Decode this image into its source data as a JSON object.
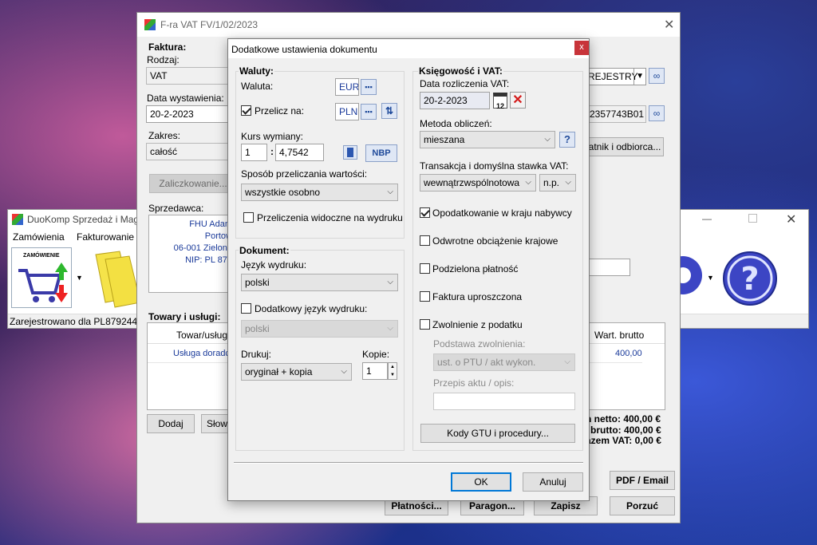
{
  "back_app": {
    "title": "DuoKomp Sprzedaż i Magazyn",
    "menu": [
      "Zamówienia",
      "Fakturowanie"
    ],
    "status": "Zarejestrowano dla PL8792446",
    "zamowienie_label": "ZAMÓWIENIE"
  },
  "invoice": {
    "title": "F-ra VAT FV/1/02/2023",
    "faktura_label": "Faktura:",
    "rodzaj_label": "Rodzaj:",
    "rodzaj_value": "VAT",
    "data_wyst_label": "Data wystawienia:",
    "data_wyst_value": "20-2-2023",
    "zakres_label": "Zakres:",
    "zakres_value": "całość",
    "zaliczkowanie": "Zaliczkowanie...",
    "sprzedawca_label": "Sprzedawca:",
    "seller": [
      "FHU Adam",
      "Portow",
      "06-001 Zielone",
      "NIP: PL 879"
    ],
    "rejestr_value": "REJESTRY",
    "nip_value": "2357743B01",
    "odbiorca_button": "atnik i odbiorca...",
    "towary_label": "Towary i usługi:",
    "col_towar": "Towar/usługa",
    "col_brutto": "Wart. brutto",
    "row_towar": "Usługa doradc",
    "row_brutto": "400,00",
    "dodaj": "Dodaj",
    "slow": "Słow",
    "netto": "n netto: 400,00 €",
    "brutto": "brutto: 400,00 €",
    "vat": "azem VAT: 0,00 €",
    "pdf": "PDF / Email",
    "platnosci": "Płatności...",
    "paragon": "Paragon...",
    "zapisz": "Zapisz",
    "porzuc": "Porzuć"
  },
  "dialog": {
    "title": "Dodatkowe ustawienia dokumentu",
    "close": "x",
    "waluty": {
      "header": "Waluty:",
      "waluta_label": "Waluta:",
      "waluta_value": "EUR",
      "przelicz_label": "Przelicz na:",
      "przelicz_value": "PLN",
      "przelicz_checked": true,
      "kurs_label": "Kurs wymiany:",
      "kurs_left": "1",
      "kurs_sep": ":",
      "kurs_right": "4,7542",
      "nbp": "NBP",
      "sposob_label": "Sposób przeliczania wartości:",
      "sposob_value": "wszystkie osobno",
      "widoczne_label": "Przeliczenia widoczne na wydruku",
      "widoczne_checked": false
    },
    "dokument": {
      "header": "Dokument:",
      "jezyk_label": "Język wydruku:",
      "jezyk_value": "polski",
      "dodatkowy_label": "Dodatkowy język wydruku:",
      "dodatkowy_checked": false,
      "dodatkowy_value": "polski",
      "drukuj_label": "Drukuj:",
      "drukuj_value": "oryginał + kopia",
      "kopie_label": "Kopie:",
      "kopie_value": "1"
    },
    "ksiegowosc": {
      "header": "Księgowość i VAT:",
      "data_label": "Data rozliczenia VAT:",
      "data_value": "20-2-2023",
      "metoda_label": "Metoda obliczeń:",
      "metoda_value": "mieszana",
      "transakcja_label": "Transakcja i domyślna stawka VAT:",
      "transakcja_value": "wewnątrzwspólnotowa",
      "stawka_value": "n.p.",
      "opodatkowanie": "Opodatkowanie w kraju nabywcy",
      "opodatkowanie_checked": true,
      "odwrotne": "Odwrotne obciążenie krajowe",
      "podzielona": "Podzielona płatność",
      "uproszczona": "Faktura uproszczona",
      "zwolnienie": "Zwolnienie z podatku",
      "podstawa_label": "Podstawa zwolnienia:",
      "podstawa_value": "ust. o PTU / akt wykon.",
      "przepis_label": "Przepis aktu / opis:",
      "przepis_value": "",
      "kody": "Kody GTU i procedury..."
    },
    "ok": "OK",
    "anuluj": "Anuluj"
  },
  "colors": {
    "accent": "#0078d7",
    "link_blue": "#1a3a9a",
    "close_red": "#c8343a"
  }
}
